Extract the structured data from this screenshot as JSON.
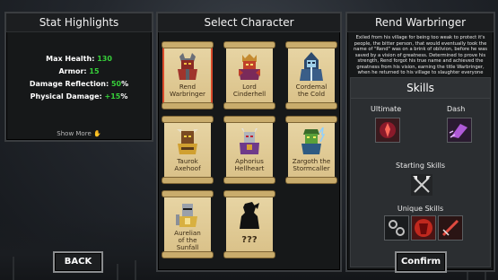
{
  "stats": {
    "title": "Stat Highlights",
    "items": [
      {
        "label": "Max Health: ",
        "value": "130"
      },
      {
        "label": "Armor: ",
        "value": "15"
      },
      {
        "label": "Damage Reflection: ",
        "value": "50",
        "suffix": "%"
      },
      {
        "label": "Physical Damage: ",
        "value": "+15",
        "suffix": "%"
      }
    ],
    "show_more": "Show More"
  },
  "select": {
    "title": "Select Character",
    "characters": [
      {
        "name": "Rend Warbringer",
        "line1": "Rend",
        "line2": "Warbringer",
        "selected": true
      },
      {
        "name": "Lord Cinderhell",
        "line1": "Lord",
        "line2": "Cinderhell"
      },
      {
        "name": "Cordemal the Cold",
        "line1": "Cordemal",
        "line2": "the Cold"
      },
      {
        "name": "Taurok Axehoof",
        "line1": "Taurok",
        "line2": "Axehoof"
      },
      {
        "name": "Aphorius Hellheart",
        "line1": "Aphorius",
        "line2": "Hellheart"
      },
      {
        "name": "Zargoth the Stormcaller",
        "line1": "Zargoth the",
        "line2": "Stormcaller"
      },
      {
        "name": "Aurelian of the Sunfall",
        "line1": "Aurelian",
        "line2": "of the",
        "line3": "Sunfall"
      },
      {
        "name": "???",
        "line1": "???"
      }
    ]
  },
  "detail": {
    "title": "Rend Warbringer",
    "bio": "Exiled from his village for being too weak to protect it's people, the bitter person, that would eventually took the name of \"Rend\" was on a brink of oblivion, before he was saved by a vision of greatness. Determined to prove his strength, Rend forgot his true name and achieved the greatness from his vision, earning the title Warbringer, when he returned to his village to slaughter everyone that once called him \"weak\".",
    "skills_title": "Skills",
    "ultimate_label": "Ultimate",
    "dash_label": "Dash",
    "starting_label": "Starting Skills",
    "unique_label": "Unique Skills"
  },
  "buttons": {
    "back": "BACK",
    "confirm": "Confirm"
  },
  "colors": {
    "accent_green": "#37d03a",
    "selected_outline": "#d94a2a",
    "parchment": "#e8d6a6"
  }
}
